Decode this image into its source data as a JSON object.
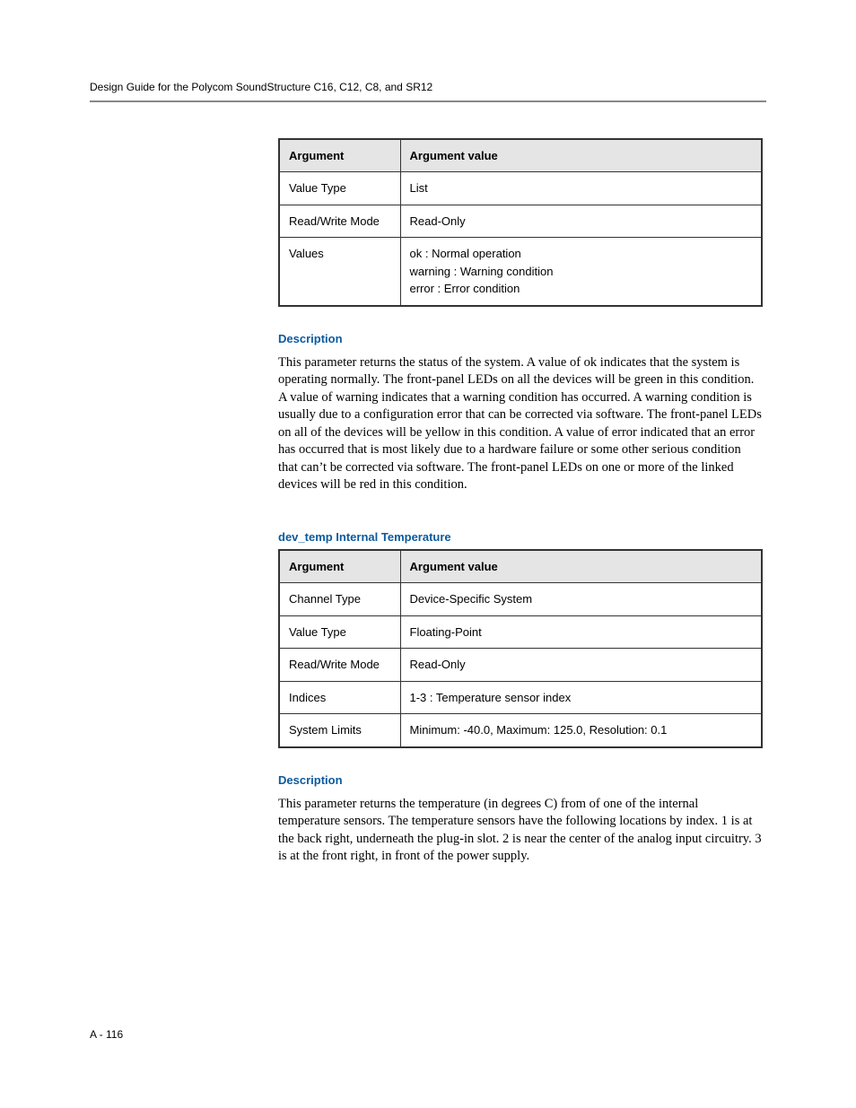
{
  "header": "Design Guide for the Polycom SoundStructure C16, C12, C8, and SR12",
  "table1": {
    "head_arg": "Argument",
    "head_val": "Argument value",
    "rows": [
      {
        "arg": "Value Type",
        "val": "List"
      },
      {
        "arg": "Read/Write Mode",
        "val": "Read-Only"
      },
      {
        "arg": "Values",
        "val_lines": [
          "ok : Normal operation",
          "warning : Warning condition",
          "error : Error condition"
        ]
      }
    ]
  },
  "section1": {
    "heading": "Description",
    "body": "This parameter returns the status of the system. A value of ok indicates that the system is operating normally. The front-panel LEDs on all the devices will be green in this condition. A value of warning indicates that a warning condition has occurred. A warning condition is usually due to a configuration error that can be corrected via software. The front-panel LEDs on all of the devices will be yellow in this condition. A value of error indicated that an error has occurred that is most likely due to a hardware failure or some other serious condition that can’t be corrected via software. The front-panel LEDs on one or more of the linked devices will be red in this condition."
  },
  "section2": {
    "heading": "dev_temp Internal Temperature"
  },
  "table2": {
    "head_arg": "Argument",
    "head_val": "Argument value",
    "rows": [
      {
        "arg": "Channel Type",
        "val": "Device-Specific System"
      },
      {
        "arg": "Value Type",
        "val": "Floating-Point"
      },
      {
        "arg": "Read/Write Mode",
        "val": "Read-Only"
      },
      {
        "arg": "Indices",
        "val": "1-3 : Temperature sensor index"
      },
      {
        "arg": "System Limits",
        "val": "Minimum: -40.0, Maximum: 125.0, Resolution: 0.1"
      }
    ]
  },
  "section3": {
    "heading": "Description",
    "body": "This parameter returns the temperature (in degrees C) from of one of the internal temperature sensors. The temperature sensors have the following locations by index. 1 is at the back right, underneath the plug-in slot. 2 is near the center of the analog input circuitry. 3 is at the front right, in front of the power supply."
  },
  "page_number": "A - 116"
}
